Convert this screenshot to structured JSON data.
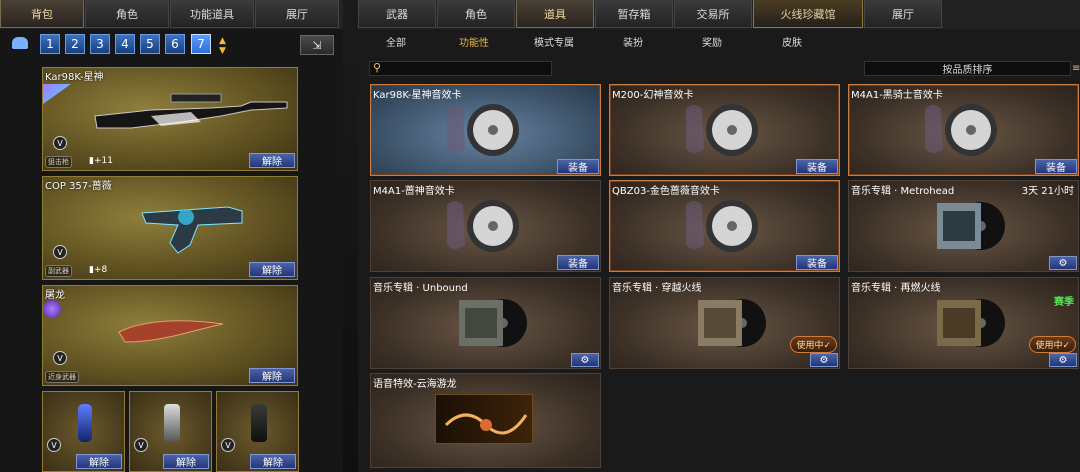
{
  "left_tabs": [
    "背包",
    "角色",
    "功能道具",
    "展厅"
  ],
  "right_tabs": [
    "武器",
    "角色",
    "道具",
    "暂存箱",
    "交易所",
    "火线珍藏馆",
    "展厅"
  ],
  "page_numbers": [
    "1",
    "2",
    "3",
    "4",
    "5",
    "6",
    "7"
  ],
  "active_page": "7",
  "filters": [
    "全部",
    "功能性",
    "模式专属",
    "装扮",
    "奖励",
    "皮肤"
  ],
  "sort_label": "按品质排序",
  "equip_label": "装备",
  "unlock_label": "解除",
  "in_use_label": "使用中✓",
  "weapons": [
    {
      "name": "Kar98K-星神",
      "category": "狙击枪",
      "bullets": "+11"
    },
    {
      "name": "COP 357-蔷薇",
      "category": "副武器",
      "bullets": "+8"
    },
    {
      "name": "屠龙",
      "category": "近身武器",
      "bullets": ""
    }
  ],
  "grenades": [
    {},
    {},
    {}
  ],
  "items": [
    {
      "title": "Kar98K-星神音效卡",
      "type": "sound",
      "action": "equip"
    },
    {
      "title": "M200-幻神音效卡",
      "type": "sound",
      "action": "equip"
    },
    {
      "title": "M4A1-黑骑士音效卡",
      "type": "sound",
      "action": "equip"
    },
    {
      "title": "M4A1-蔷神音效卡",
      "type": "sound",
      "action": "equip"
    },
    {
      "title": "QBZ03-金色蔷薇音效卡",
      "type": "sound",
      "action": "equip"
    },
    {
      "title": "音乐专辑 · Metrohead",
      "type": "album",
      "action": "gear",
      "extra": "3天 21小时"
    },
    {
      "title": "音乐专辑 · Unbound",
      "type": "album",
      "action": "gear"
    },
    {
      "title": "音乐专辑 · 穿越火线",
      "type": "album",
      "action": "gear",
      "in_use": true
    },
    {
      "title": "音乐专辑 · 再燃火线",
      "type": "album",
      "action": "gear",
      "in_use": true,
      "extra": "赛季"
    },
    {
      "title": "语音特效-云海游龙",
      "type": "voice",
      "action": "none"
    }
  ]
}
